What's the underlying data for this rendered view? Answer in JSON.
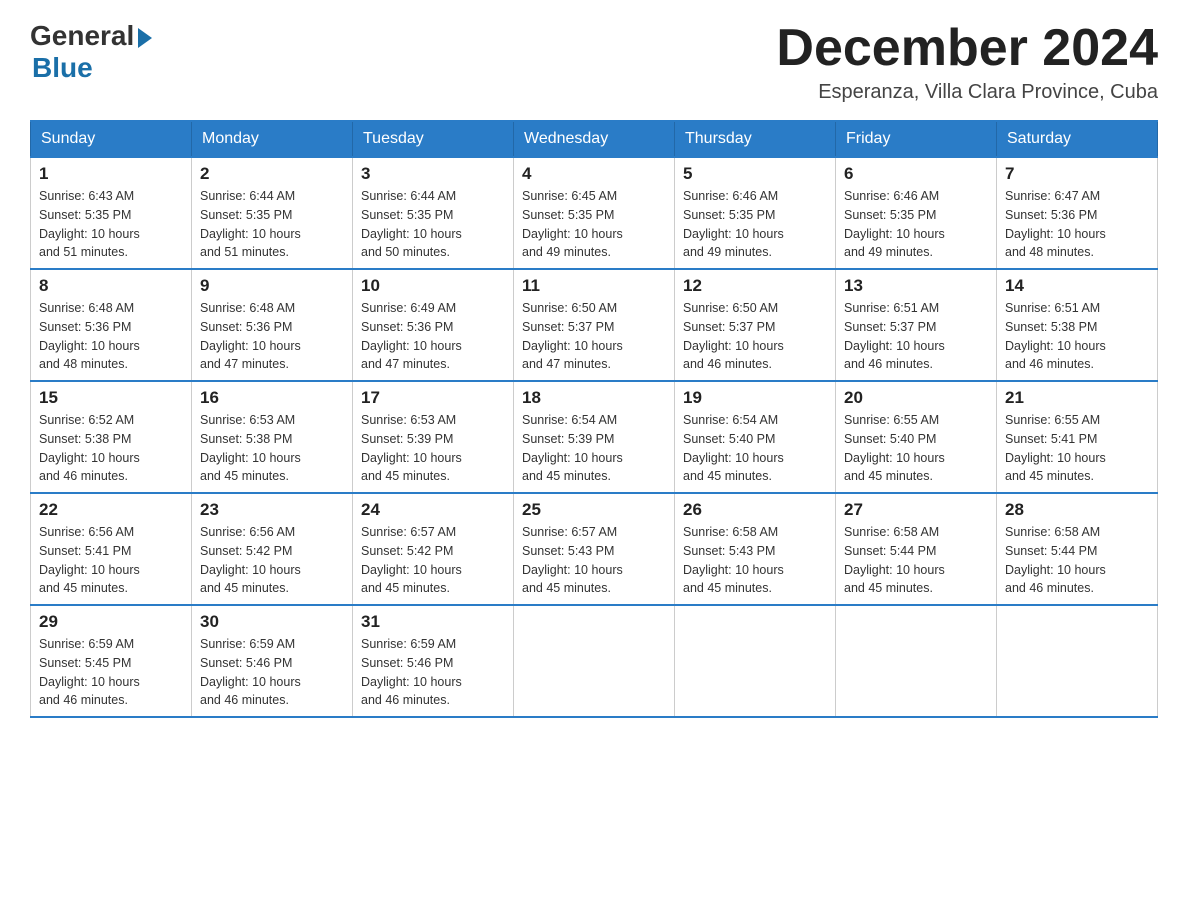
{
  "logo": {
    "general": "General",
    "blue": "Blue"
  },
  "title": "December 2024",
  "subtitle": "Esperanza, Villa Clara Province, Cuba",
  "days_header": [
    "Sunday",
    "Monday",
    "Tuesday",
    "Wednesday",
    "Thursday",
    "Friday",
    "Saturday"
  ],
  "weeks": [
    [
      {
        "day": "1",
        "sunrise": "6:43 AM",
        "sunset": "5:35 PM",
        "daylight": "10 hours and 51 minutes."
      },
      {
        "day": "2",
        "sunrise": "6:44 AM",
        "sunset": "5:35 PM",
        "daylight": "10 hours and 51 minutes."
      },
      {
        "day": "3",
        "sunrise": "6:44 AM",
        "sunset": "5:35 PM",
        "daylight": "10 hours and 50 minutes."
      },
      {
        "day": "4",
        "sunrise": "6:45 AM",
        "sunset": "5:35 PM",
        "daylight": "10 hours and 49 minutes."
      },
      {
        "day": "5",
        "sunrise": "6:46 AM",
        "sunset": "5:35 PM",
        "daylight": "10 hours and 49 minutes."
      },
      {
        "day": "6",
        "sunrise": "6:46 AM",
        "sunset": "5:35 PM",
        "daylight": "10 hours and 49 minutes."
      },
      {
        "day": "7",
        "sunrise": "6:47 AM",
        "sunset": "5:36 PM",
        "daylight": "10 hours and 48 minutes."
      }
    ],
    [
      {
        "day": "8",
        "sunrise": "6:48 AM",
        "sunset": "5:36 PM",
        "daylight": "10 hours and 48 minutes."
      },
      {
        "day": "9",
        "sunrise": "6:48 AM",
        "sunset": "5:36 PM",
        "daylight": "10 hours and 47 minutes."
      },
      {
        "day": "10",
        "sunrise": "6:49 AM",
        "sunset": "5:36 PM",
        "daylight": "10 hours and 47 minutes."
      },
      {
        "day": "11",
        "sunrise": "6:50 AM",
        "sunset": "5:37 PM",
        "daylight": "10 hours and 47 minutes."
      },
      {
        "day": "12",
        "sunrise": "6:50 AM",
        "sunset": "5:37 PM",
        "daylight": "10 hours and 46 minutes."
      },
      {
        "day": "13",
        "sunrise": "6:51 AM",
        "sunset": "5:37 PM",
        "daylight": "10 hours and 46 minutes."
      },
      {
        "day": "14",
        "sunrise": "6:51 AM",
        "sunset": "5:38 PM",
        "daylight": "10 hours and 46 minutes."
      }
    ],
    [
      {
        "day": "15",
        "sunrise": "6:52 AM",
        "sunset": "5:38 PM",
        "daylight": "10 hours and 46 minutes."
      },
      {
        "day": "16",
        "sunrise": "6:53 AM",
        "sunset": "5:38 PM",
        "daylight": "10 hours and 45 minutes."
      },
      {
        "day": "17",
        "sunrise": "6:53 AM",
        "sunset": "5:39 PM",
        "daylight": "10 hours and 45 minutes."
      },
      {
        "day": "18",
        "sunrise": "6:54 AM",
        "sunset": "5:39 PM",
        "daylight": "10 hours and 45 minutes."
      },
      {
        "day": "19",
        "sunrise": "6:54 AM",
        "sunset": "5:40 PM",
        "daylight": "10 hours and 45 minutes."
      },
      {
        "day": "20",
        "sunrise": "6:55 AM",
        "sunset": "5:40 PM",
        "daylight": "10 hours and 45 minutes."
      },
      {
        "day": "21",
        "sunrise": "6:55 AM",
        "sunset": "5:41 PM",
        "daylight": "10 hours and 45 minutes."
      }
    ],
    [
      {
        "day": "22",
        "sunrise": "6:56 AM",
        "sunset": "5:41 PM",
        "daylight": "10 hours and 45 minutes."
      },
      {
        "day": "23",
        "sunrise": "6:56 AM",
        "sunset": "5:42 PM",
        "daylight": "10 hours and 45 minutes."
      },
      {
        "day": "24",
        "sunrise": "6:57 AM",
        "sunset": "5:42 PM",
        "daylight": "10 hours and 45 minutes."
      },
      {
        "day": "25",
        "sunrise": "6:57 AM",
        "sunset": "5:43 PM",
        "daylight": "10 hours and 45 minutes."
      },
      {
        "day": "26",
        "sunrise": "6:58 AM",
        "sunset": "5:43 PM",
        "daylight": "10 hours and 45 minutes."
      },
      {
        "day": "27",
        "sunrise": "6:58 AM",
        "sunset": "5:44 PM",
        "daylight": "10 hours and 45 minutes."
      },
      {
        "day": "28",
        "sunrise": "6:58 AM",
        "sunset": "5:44 PM",
        "daylight": "10 hours and 46 minutes."
      }
    ],
    [
      {
        "day": "29",
        "sunrise": "6:59 AM",
        "sunset": "5:45 PM",
        "daylight": "10 hours and 46 minutes."
      },
      {
        "day": "30",
        "sunrise": "6:59 AM",
        "sunset": "5:46 PM",
        "daylight": "10 hours and 46 minutes."
      },
      {
        "day": "31",
        "sunrise": "6:59 AM",
        "sunset": "5:46 PM",
        "daylight": "10 hours and 46 minutes."
      },
      null,
      null,
      null,
      null
    ]
  ],
  "labels": {
    "sunrise": "Sunrise:",
    "sunset": "Sunset:",
    "daylight": "Daylight:"
  }
}
